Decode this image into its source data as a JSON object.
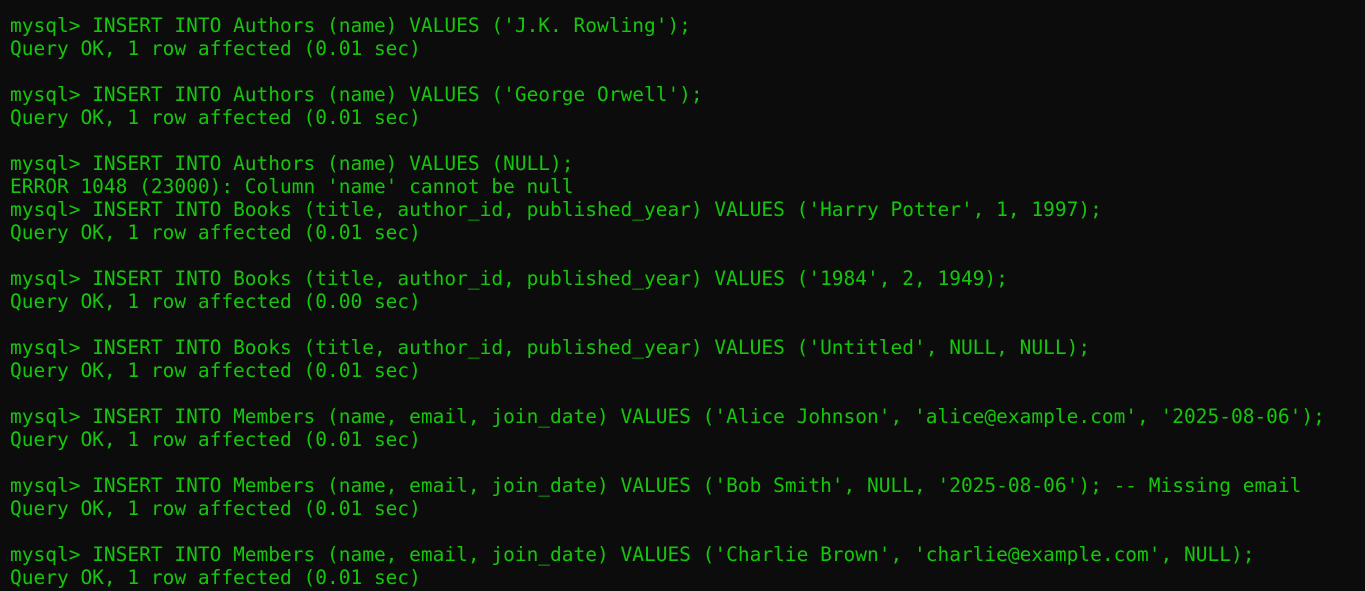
{
  "terminal": {
    "prompt": "mysql> ",
    "colors": {
      "background": "#0c0c0c",
      "text": "#16c60c"
    },
    "lines": [
      {
        "kind": "cmd",
        "text": "INSERT INTO Authors (name) VALUES ('J.K. Rowling');"
      },
      {
        "kind": "out",
        "text": "Query OK, 1 row affected (0.01 sec)"
      },
      {
        "kind": "blank",
        "text": ""
      },
      {
        "kind": "cmd",
        "text": "INSERT INTO Authors (name) VALUES ('George Orwell');"
      },
      {
        "kind": "out",
        "text": "Query OK, 1 row affected (0.01 sec)"
      },
      {
        "kind": "blank",
        "text": ""
      },
      {
        "kind": "cmd",
        "text": "INSERT INTO Authors (name) VALUES (NULL);"
      },
      {
        "kind": "err",
        "text": "ERROR 1048 (23000): Column 'name' cannot be null"
      },
      {
        "kind": "cmd",
        "text": "INSERT INTO Books (title, author_id, published_year) VALUES ('Harry Potter', 1, 1997);"
      },
      {
        "kind": "out",
        "text": "Query OK, 1 row affected (0.01 sec)"
      },
      {
        "kind": "blank",
        "text": ""
      },
      {
        "kind": "cmd",
        "text": "INSERT INTO Books (title, author_id, published_year) VALUES ('1984', 2, 1949);"
      },
      {
        "kind": "out",
        "text": "Query OK, 1 row affected (0.00 sec)"
      },
      {
        "kind": "blank",
        "text": ""
      },
      {
        "kind": "cmd",
        "text": "INSERT INTO Books (title, author_id, published_year) VALUES ('Untitled', NULL, NULL);"
      },
      {
        "kind": "out",
        "text": "Query OK, 1 row affected (0.01 sec)"
      },
      {
        "kind": "blank",
        "text": ""
      },
      {
        "kind": "cmd",
        "text": "INSERT INTO Members (name, email, join_date) VALUES ('Alice Johnson', 'alice@example.com', '2025-08-06');"
      },
      {
        "kind": "out",
        "text": "Query OK, 1 row affected (0.01 sec)"
      },
      {
        "kind": "blank",
        "text": ""
      },
      {
        "kind": "cmd",
        "text": "INSERT INTO Members (name, email, join_date) VALUES ('Bob Smith', NULL, '2025-08-06'); -- Missing email"
      },
      {
        "kind": "out",
        "text": "Query OK, 1 row affected (0.01 sec)"
      },
      {
        "kind": "blank",
        "text": ""
      },
      {
        "kind": "cmd",
        "text": "INSERT INTO Members (name, email, join_date) VALUES ('Charlie Brown', 'charlie@example.com', NULL);"
      },
      {
        "kind": "out",
        "text": "Query OK, 1 row affected (0.01 sec)"
      }
    ]
  }
}
